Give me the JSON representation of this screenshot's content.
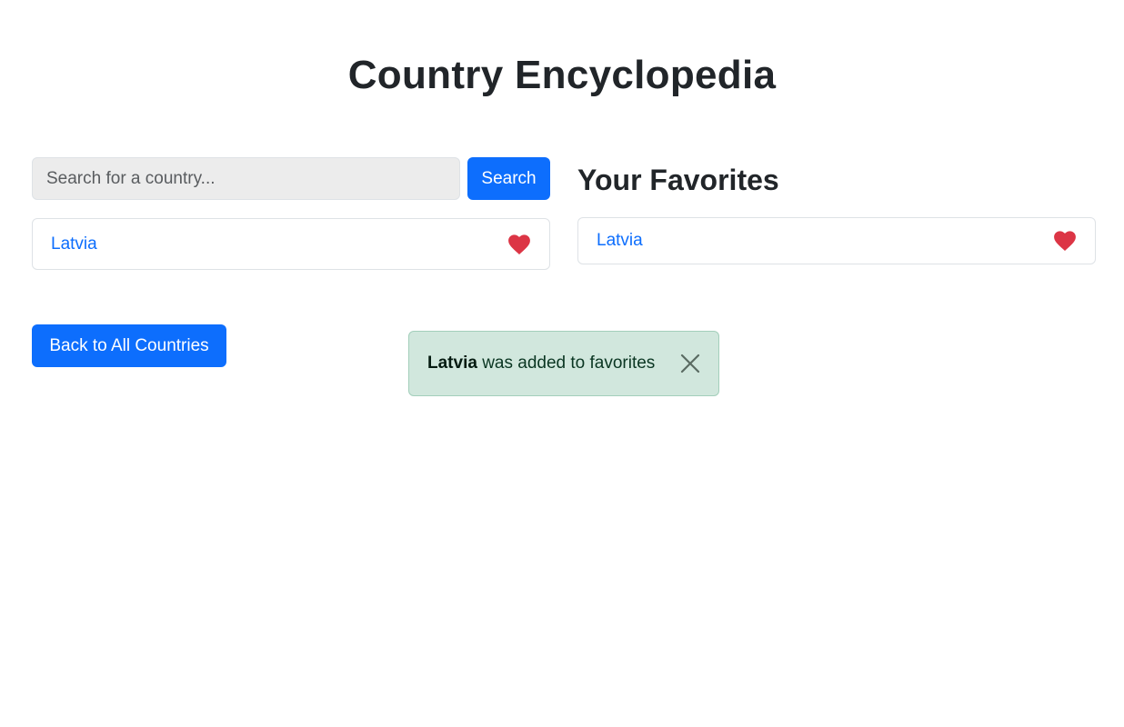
{
  "header": {
    "title": "Country Encyclopedia"
  },
  "search": {
    "placeholder": "Search for a country...",
    "value": "",
    "button_label": "Search"
  },
  "results": [
    {
      "name": "Latvia",
      "favorited": true
    }
  ],
  "favorites": {
    "heading": "Your Favorites",
    "items": [
      {
        "name": "Latvia",
        "favorited": true
      }
    ]
  },
  "navigation": {
    "back_label": "Back to All Countries"
  },
  "toast": {
    "country": "Latvia",
    "message": " was added to favorites",
    "close_icon": "close-icon"
  },
  "colors": {
    "primary": "#0d6efd",
    "heart": "#dc3545",
    "toast_bg": "#d1e7dd",
    "toast_border": "#a3cfbb"
  },
  "icons": {
    "favorite": "heart-icon",
    "close": "close-icon"
  }
}
